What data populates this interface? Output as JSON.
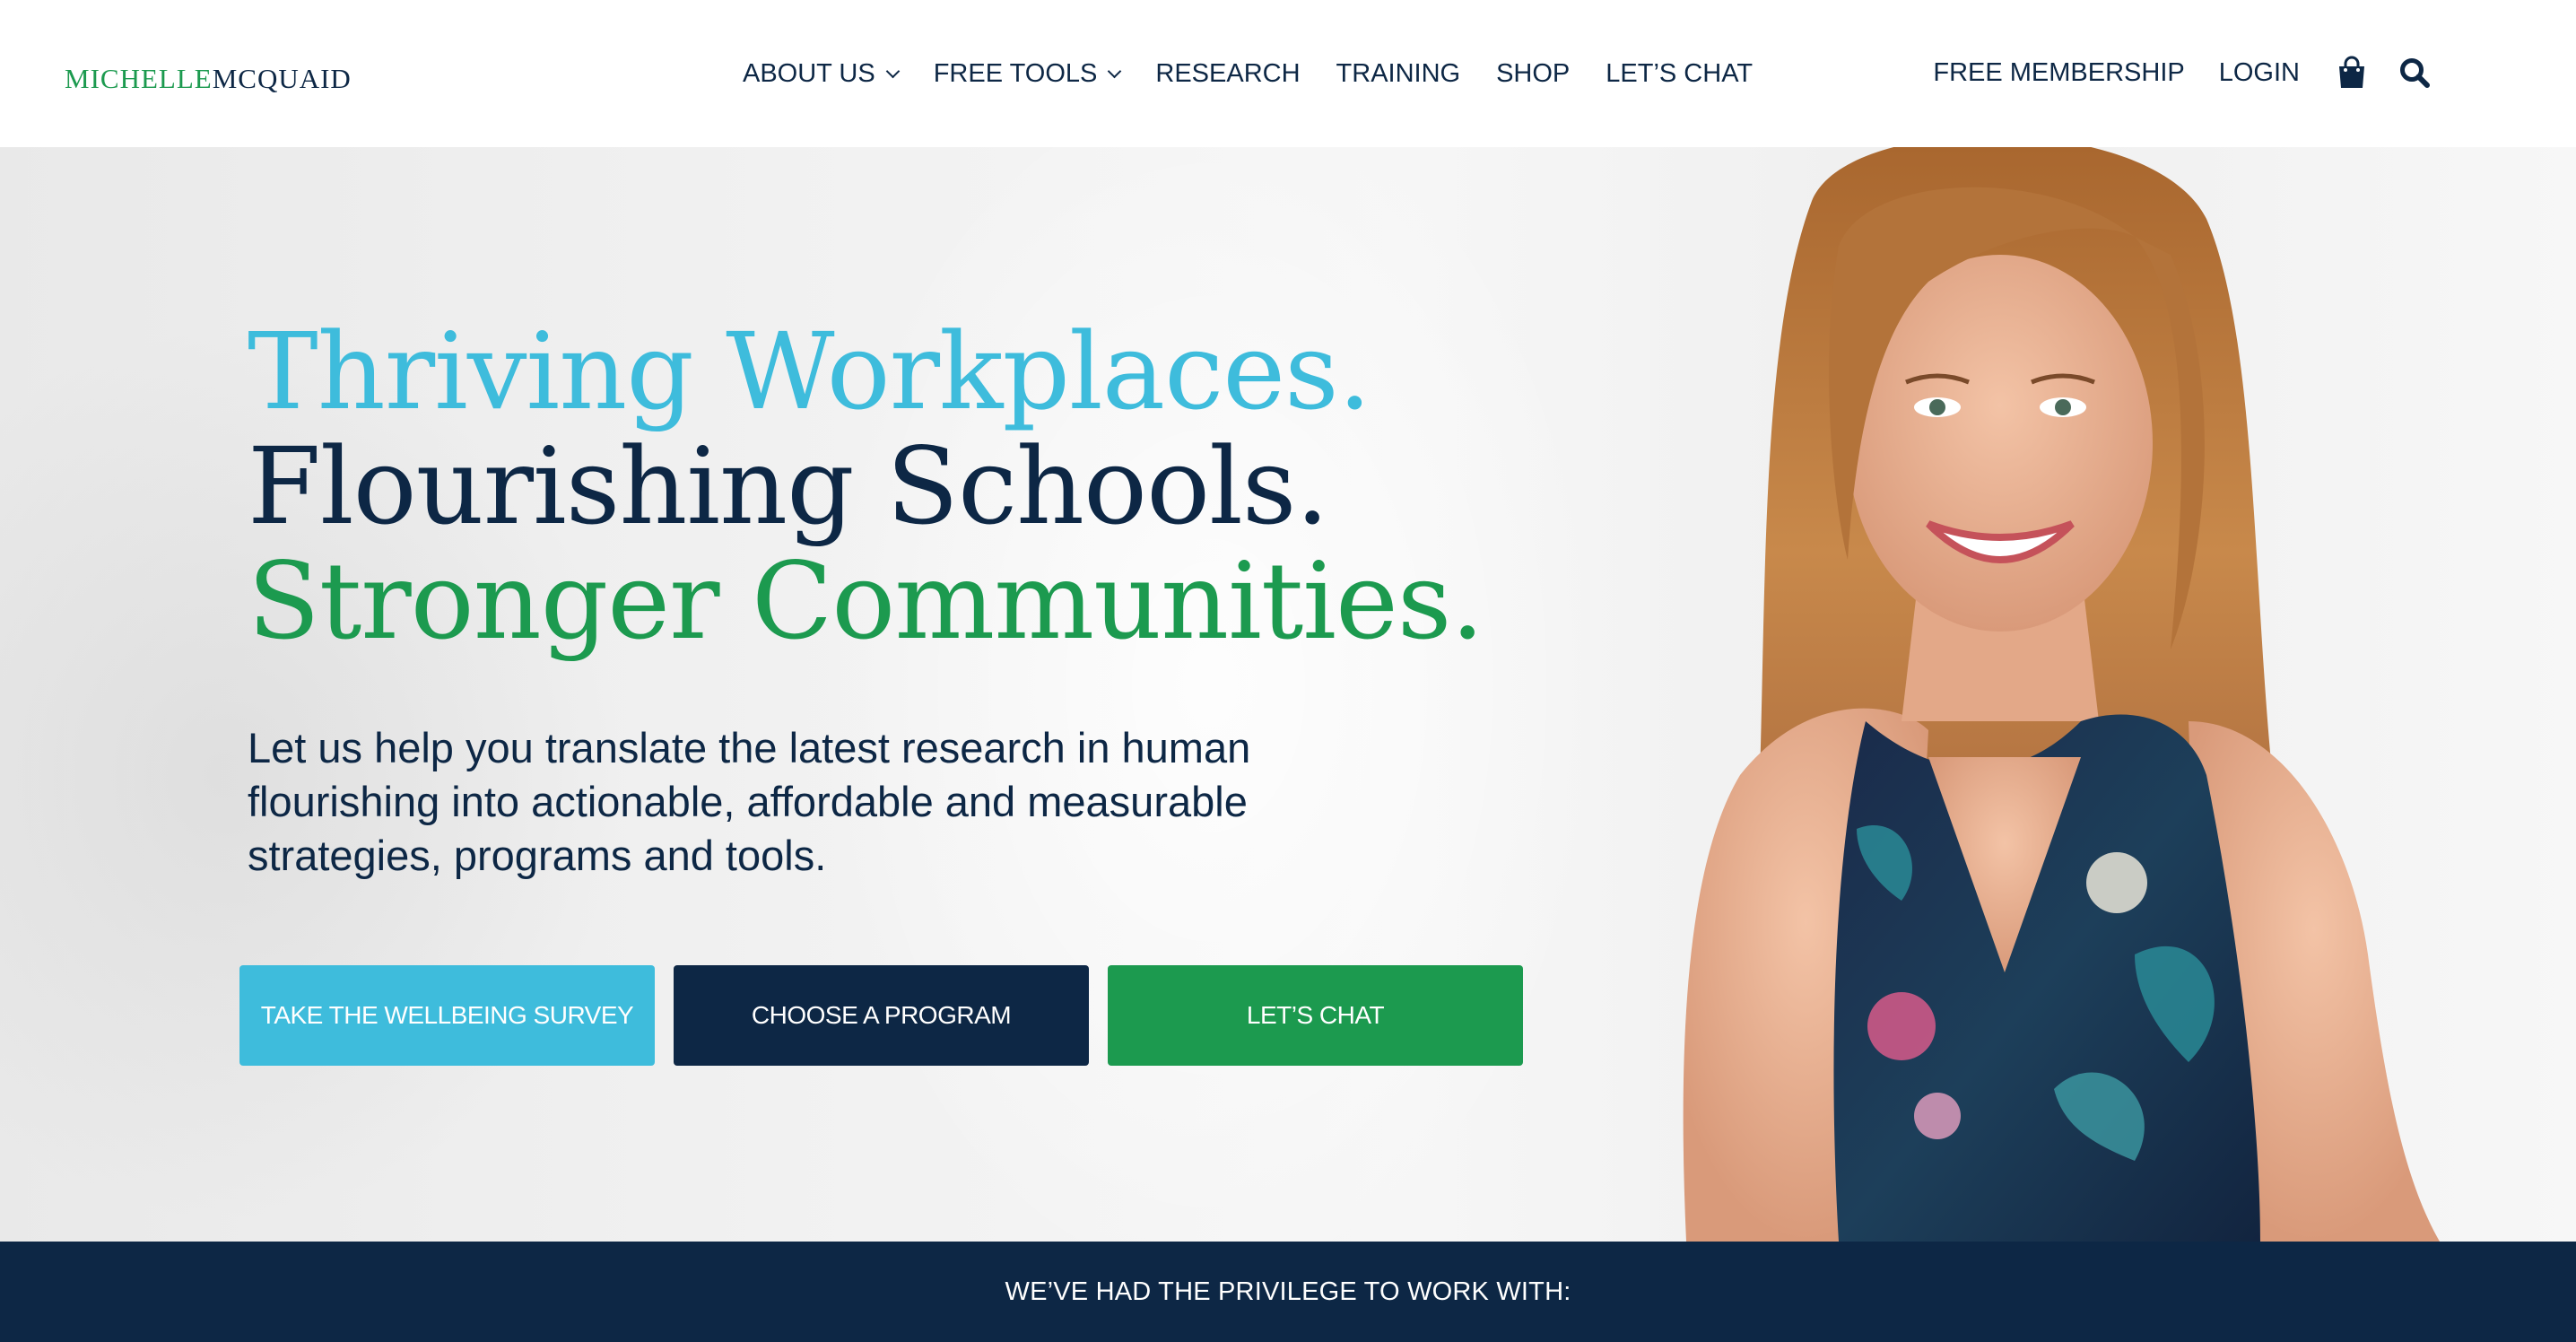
{
  "brand": {
    "logo_first": "michelle",
    "logo_last": "mcquaid",
    "colors": {
      "navy": "#0d2745",
      "blue": "#3ebcdc",
      "green": "#1c9a4f"
    }
  },
  "nav": {
    "items": [
      {
        "label": "ABOUT US",
        "dropdown": true
      },
      {
        "label": "FREE TOOLS",
        "dropdown": true
      },
      {
        "label": "RESEARCH",
        "dropdown": false
      },
      {
        "label": "TRAINING",
        "dropdown": false
      },
      {
        "label": "SHOP",
        "dropdown": false
      },
      {
        "label": "LET’S CHAT",
        "dropdown": false
      }
    ]
  },
  "utility": {
    "membership_label": "FREE MEMBERSHIP",
    "login_label": "LOGIN",
    "cart_icon": "shopping-bag-icon",
    "search_icon": "search-icon"
  },
  "hero": {
    "headline_line1": "Thriving Workplaces.",
    "headline_line2": "Flourishing Schools.",
    "headline_line3": "Stronger Communities.",
    "subtext": "Let us help you translate the latest research in human flourishing into actionable, affordable and measurable strategies, programs and tools.",
    "cta_survey": "TAKE THE WELLBEING SURVEY",
    "cta_program": "CHOOSE A PROGRAM",
    "cta_chat": "LET’S CHAT"
  },
  "clients_strip": {
    "label": "WE’VE HAD THE PRIVILEGE TO WORK WITH:"
  }
}
